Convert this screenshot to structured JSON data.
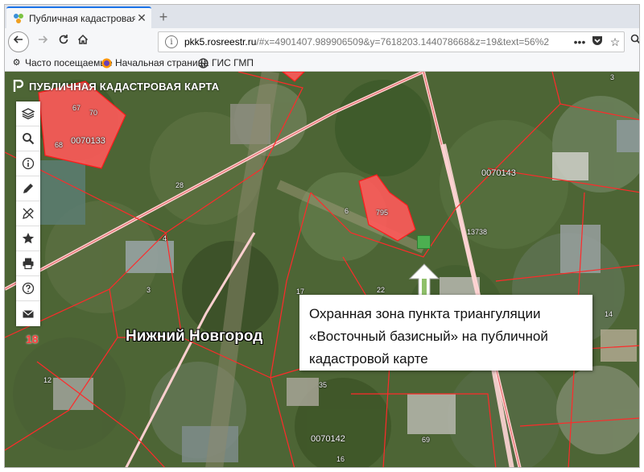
{
  "browser": {
    "tab_title": "Публичная кадастровая карта",
    "url_host": "pkk5.rosreestr.ru",
    "url_rest": "/#x=4901407.989906509&y=7618203.144078668&z=19&text=56%2",
    "bookmarks": [
      {
        "label": "Часто посещаемые",
        "icon": "gear-icon"
      },
      {
        "label": "Начальная страница",
        "icon": "firefox-icon"
      },
      {
        "label": "ГИС ГМП",
        "icon": "globe-icon"
      }
    ]
  },
  "app": {
    "brand": "ПУБЛИЧНАЯ КАДАСТРОВАЯ КАРТА",
    "tools": [
      {
        "name": "layers-tool",
        "icon": "layers-icon"
      },
      {
        "name": "search-tool",
        "icon": "search-icon"
      },
      {
        "name": "info-tool",
        "icon": "info-icon"
      },
      {
        "name": "draw-tool",
        "icon": "pencil-icon"
      },
      {
        "name": "measure-tool",
        "icon": "ruler-pen-icon"
      },
      {
        "name": "favorites-tool",
        "icon": "star-icon"
      },
      {
        "name": "print-tool",
        "icon": "printer-icon"
      },
      {
        "name": "help-tool",
        "icon": "help-icon"
      },
      {
        "name": "mail-tool",
        "icon": "mail-icon"
      }
    ]
  },
  "map": {
    "city": "Нижний Новгород",
    "district_number": "18",
    "labels": [
      "67",
      "70",
      "68",
      "0070133",
      "28",
      "6",
      "795",
      "13738",
      "0070143",
      "4",
      "3",
      "17",
      "22",
      "14",
      "12",
      "35",
      "69",
      "0070142",
      "16",
      "3"
    ],
    "colors": {
      "parcel_fill": "#ff5a5a",
      "boundary": "#ff2020",
      "road": "#ffd7d7",
      "marker": "#4caf50"
    }
  },
  "callout": {
    "line1": "Охранная зона пункта триангуляции",
    "line2": "«Восточный базисный» на публичной",
    "line3": "кадастровой карте"
  }
}
